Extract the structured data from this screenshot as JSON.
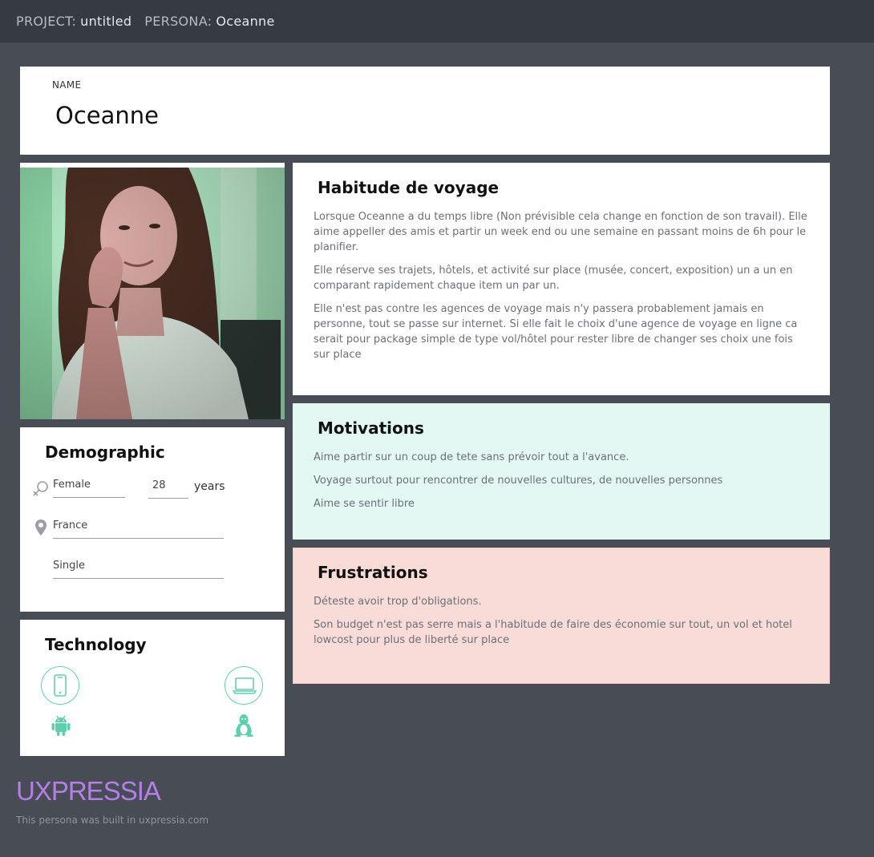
{
  "topbar": {
    "project_label": "PROJECT:",
    "project_value": "untitled",
    "persona_label": "PERSONA:",
    "persona_value": "Oceanne"
  },
  "name_card": {
    "label": "NAME",
    "value": "Oceanne"
  },
  "demographic": {
    "title": "Demographic",
    "gender": "Female",
    "age": "28",
    "age_unit": "years",
    "location": "France",
    "status": "Single"
  },
  "technology": {
    "title": "Technology",
    "devices": [
      "phone-icon",
      "laptop-icon"
    ],
    "platforms": [
      "android-icon",
      "linux-icon"
    ]
  },
  "habit": {
    "title": "Habitude de voyage",
    "paragraphs": [
      "Lorsque Oceanne a du temps libre (Non prévisible cela change en fonction de son travail). Elle aime appeller des amis et partir un week end ou une semaine en passant moins de 6h pour le planifier.",
      "Elle réserve ses trajets,  hôtels, et activité sur place (musée, concert, exposition) un a un en comparant rapidement chaque item un par un.",
      "Elle n'est pas contre les agences de voyage mais n'y passera probablement jamais en personne, tout se passe sur internet. Si elle fait le choix d'une agence de voyage en ligne ca serait pour package simple de type vol/hôtel pour rester libre de changer ses choix une fois sur place"
    ]
  },
  "motivations": {
    "title": "Motivations",
    "paragraphs": [
      "Aime partir sur un coup de tete sans prévoir tout a l'avance.",
      "Voyage surtout pour rencontrer de nouvelles cultures, de nouvelles personnes",
      "Aime se sentir libre"
    ]
  },
  "frustrations": {
    "title": "Frustrations",
    "paragraphs": [
      "Déteste avoir trop d'obligations.",
      "Son budget n'est pas serre mais a l'habitude de faire des économie sur tout, un vol et hotel lowcost pour plus de liberté  sur place"
    ]
  },
  "footer": {
    "brand": "UXPRESSIA",
    "note": "This persona was built in uxpressia.com"
  },
  "colors": {
    "background": "#474c55",
    "topbar": "#363a42",
    "motivations_bg": "#e3f8f3",
    "frustrations_bg": "#f9dcd8",
    "icon_accent": "#5ed0b0",
    "brand": "#b57ee8"
  }
}
